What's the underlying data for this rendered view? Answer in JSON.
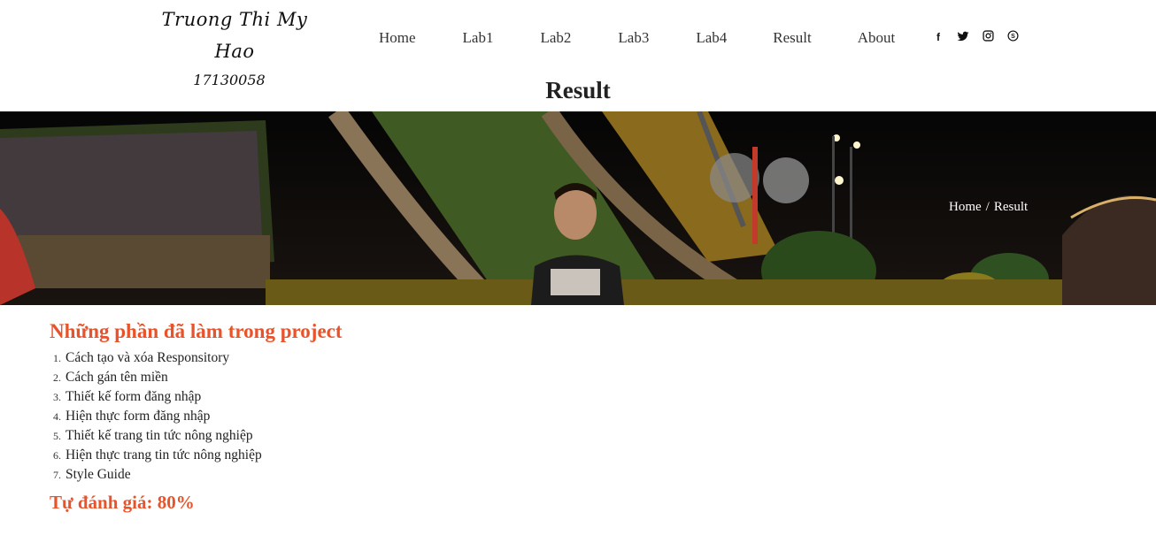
{
  "header": {
    "author_name": "Truong Thi My Hao",
    "student_id": "17130058",
    "nav": [
      {
        "label": "Home"
      },
      {
        "label": "Lab1"
      },
      {
        "label": "Lab2"
      },
      {
        "label": "Lab3"
      },
      {
        "label": "Lab4"
      },
      {
        "label": "Result"
      },
      {
        "label": "About"
      }
    ],
    "social": [
      {
        "icon": "facebook-icon",
        "glyph": "f"
      },
      {
        "icon": "twitter-icon",
        "glyph": "t"
      },
      {
        "icon": "instagram-icon",
        "glyph": "◎"
      },
      {
        "icon": "skype-icon",
        "glyph": "S"
      }
    ]
  },
  "page_title": "Result",
  "hero": {
    "breadcrumb_home": "Home",
    "breadcrumb_separator": "/",
    "breadcrumb_current": "Result"
  },
  "content": {
    "section_title": "Những phần đã làm trong project",
    "tasks": [
      {
        "num": "1.",
        "text": "Cách tạo và xóa Responsitory"
      },
      {
        "num": "2.",
        "text": "Cách gán tên miền"
      },
      {
        "num": "3.",
        "text": "Thiết kế form đăng nhập"
      },
      {
        "num": "4.",
        "text": "Hiện thực form đăng nhập"
      },
      {
        "num": "5.",
        "text": "Thiết kế trang tin tức nông nghiệp"
      },
      {
        "num": "6.",
        "text": "Hiện thực trang tin tức nông nghiệp"
      },
      {
        "num": "7.",
        "text": "Style Guide"
      }
    ],
    "self_rating": "Tự đánh giá: 80%"
  },
  "colors": {
    "accent": "#e8532b",
    "text": "#222222",
    "hero_bg": "#0b0b0b"
  }
}
